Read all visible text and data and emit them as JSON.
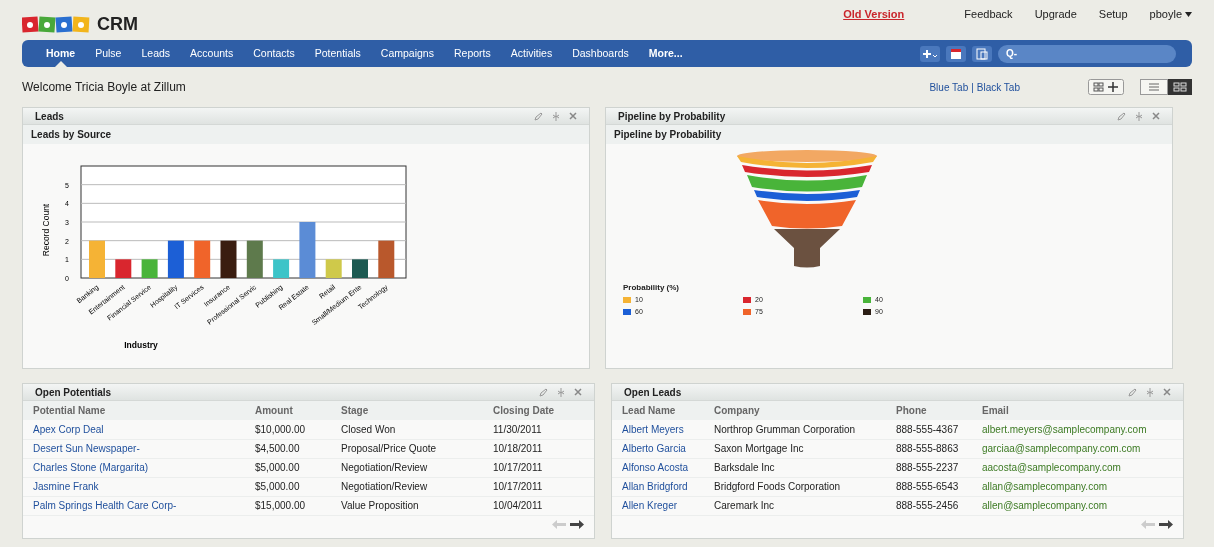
{
  "header": {
    "logo_text": "CRM",
    "links": [
      {
        "label": "Old Version",
        "kind": "alert"
      },
      {
        "label": "Feedback",
        "kind": "plain"
      },
      {
        "label": "Upgrade",
        "kind": "plain"
      },
      {
        "label": "Setup",
        "kind": "plain"
      },
      {
        "label": "pboyle",
        "kind": "menu"
      }
    ]
  },
  "nav": {
    "tabs": [
      {
        "label": "Home",
        "selected": true
      },
      {
        "label": "Pulse",
        "selected": false
      },
      {
        "label": "Leads",
        "selected": false
      },
      {
        "label": "Accounts",
        "selected": false
      },
      {
        "label": "Contacts",
        "selected": false
      },
      {
        "label": "Potentials",
        "selected": false
      },
      {
        "label": "Campaigns",
        "selected": false
      },
      {
        "label": "Reports",
        "selected": false
      },
      {
        "label": "Activities",
        "selected": false
      },
      {
        "label": "Dashboards",
        "selected": false
      },
      {
        "label": "More...",
        "selected": false
      }
    ],
    "search": {
      "placeholder": "Q-"
    }
  },
  "welcome": "Welcome Tricia Boyle at Zillum",
  "theme_links": [
    "Blue Tab",
    "|",
    "Black Tab"
  ],
  "leads_panel": {
    "title": "Leads",
    "subtitle": "Leads by Source",
    "chart_data": {
      "type": "bar",
      "xlabel": "Industry",
      "ylabel": "Record Count",
      "categories": [
        "Banking",
        "Entertainment",
        "Financial Service",
        "Hospitality",
        "IT Services",
        "Insurance",
        "Professional Servic",
        "Publishing",
        "Real Estate",
        "Retail",
        "Small/Medium Ente",
        "Technology"
      ],
      "stacked": true,
      "series": [
        {
          "color": "#f5b335",
          "values": [
            2,
            null,
            null,
            null,
            null,
            null,
            null,
            null,
            null,
            null,
            null,
            null
          ]
        },
        {
          "color": "#d9262e",
          "values": [
            null,
            1,
            null,
            null,
            null,
            null,
            null,
            null,
            null,
            null,
            null,
            null
          ]
        },
        {
          "color": "#49b43a",
          "values": [
            null,
            null,
            1,
            null,
            null,
            null,
            null,
            null,
            null,
            null,
            null,
            null
          ]
        },
        {
          "color": "#1c5fd6",
          "values": [
            null,
            null,
            null,
            2,
            null,
            null,
            null,
            null,
            null,
            null,
            null,
            null
          ]
        },
        {
          "color": "#f0642a",
          "values": [
            null,
            null,
            null,
            null,
            2,
            null,
            null,
            null,
            null,
            null,
            null,
            null
          ]
        },
        {
          "color": "#3a1d10",
          "values": [
            null,
            null,
            null,
            null,
            null,
            2,
            null,
            null,
            null,
            null,
            null,
            null
          ]
        },
        {
          "color": "#5e7a4c",
          "values": [
            null,
            null,
            null,
            null,
            null,
            null,
            2,
            null,
            null,
            null,
            null,
            null
          ]
        },
        {
          "color": "#3cc4c8",
          "values": [
            null,
            null,
            null,
            null,
            null,
            null,
            null,
            1,
            null,
            null,
            null,
            null
          ]
        },
        {
          "color": "#5b8cd6",
          "values": [
            null,
            null,
            null,
            null,
            null,
            null,
            null,
            null,
            3,
            null,
            null,
            null
          ]
        },
        {
          "color": "#cfc94a",
          "values": [
            null,
            null,
            null,
            null,
            null,
            null,
            null,
            null,
            null,
            1,
            null,
            null
          ]
        },
        {
          "color": "#1d5a52",
          "values": [
            null,
            null,
            null,
            null,
            null,
            null,
            null,
            null,
            null,
            null,
            1,
            null
          ]
        },
        {
          "color": "#b9582c",
          "values": [
            null,
            null,
            null,
            null,
            null,
            null,
            null,
            null,
            null,
            null,
            null,
            2
          ]
        }
      ],
      "ylim": [
        0,
        6
      ],
      "yticks": [
        0,
        1,
        2,
        3,
        4,
        5
      ],
      "grid": true
    }
  },
  "pipeline_panel": {
    "title": "Pipeline by Probability",
    "subtitle": "Pipeline by Probability",
    "legend_title": "Probability (%)",
    "legend": [
      {
        "label": "10",
        "color": "#f5b335"
      },
      {
        "label": "20",
        "color": "#d9262e"
      },
      {
        "label": "40",
        "color": "#49b43a"
      },
      {
        "label": "60",
        "color": "#1c5fd6"
      },
      {
        "label": "75",
        "color": "#f0642a"
      },
      {
        "label": "90",
        "color": "#2b1d14"
      }
    ]
  },
  "potentials_panel": {
    "title": "Open Potentials",
    "columns": [
      "Potential Name",
      "Amount",
      "Stage",
      "Closing Date"
    ],
    "rows": [
      [
        "Apex Corp Deal",
        "$10,000.00",
        "Closed Won",
        "11/30/2011"
      ],
      [
        "Desert Sun Newspaper-",
        "$4,500.00",
        "Proposal/Price Quote",
        "10/18/2011"
      ],
      [
        "Charles Stone (Margarita)",
        "$5,000.00",
        "Negotiation/Review",
        "10/17/2011"
      ],
      [
        "Jasmine Frank",
        "$5,000.00",
        "Negotiation/Review",
        "10/17/2011"
      ],
      [
        "Palm Springs Health Care Corp-",
        "$15,000.00",
        "Value Proposition",
        "10/04/2011"
      ]
    ]
  },
  "leads_table_panel": {
    "title": "Open Leads",
    "columns": [
      "Lead Name",
      "Company",
      "Phone",
      "Email"
    ],
    "rows": [
      [
        "Albert Meyers",
        "Northrop Grumman Corporation",
        "888-555-4367",
        "albert.meyers@samplecompany.com"
      ],
      [
        "Alberto Garcia",
        "Saxon Mortgage Inc",
        "888-555-8863",
        "garciaa@samplecompany.com.com"
      ],
      [
        "Alfonso Acosta",
        "Barksdale Inc",
        "888-555-2237",
        "aacosta@samplecompany.com"
      ],
      [
        "Allan Bridgford",
        "Bridgford Foods Corporation",
        "888-555-6543",
        "allan@samplecompany.com"
      ],
      [
        "Allen Kreger",
        "Caremark Inc",
        "888-555-2456",
        "allen@samplecompany.com"
      ]
    ]
  }
}
